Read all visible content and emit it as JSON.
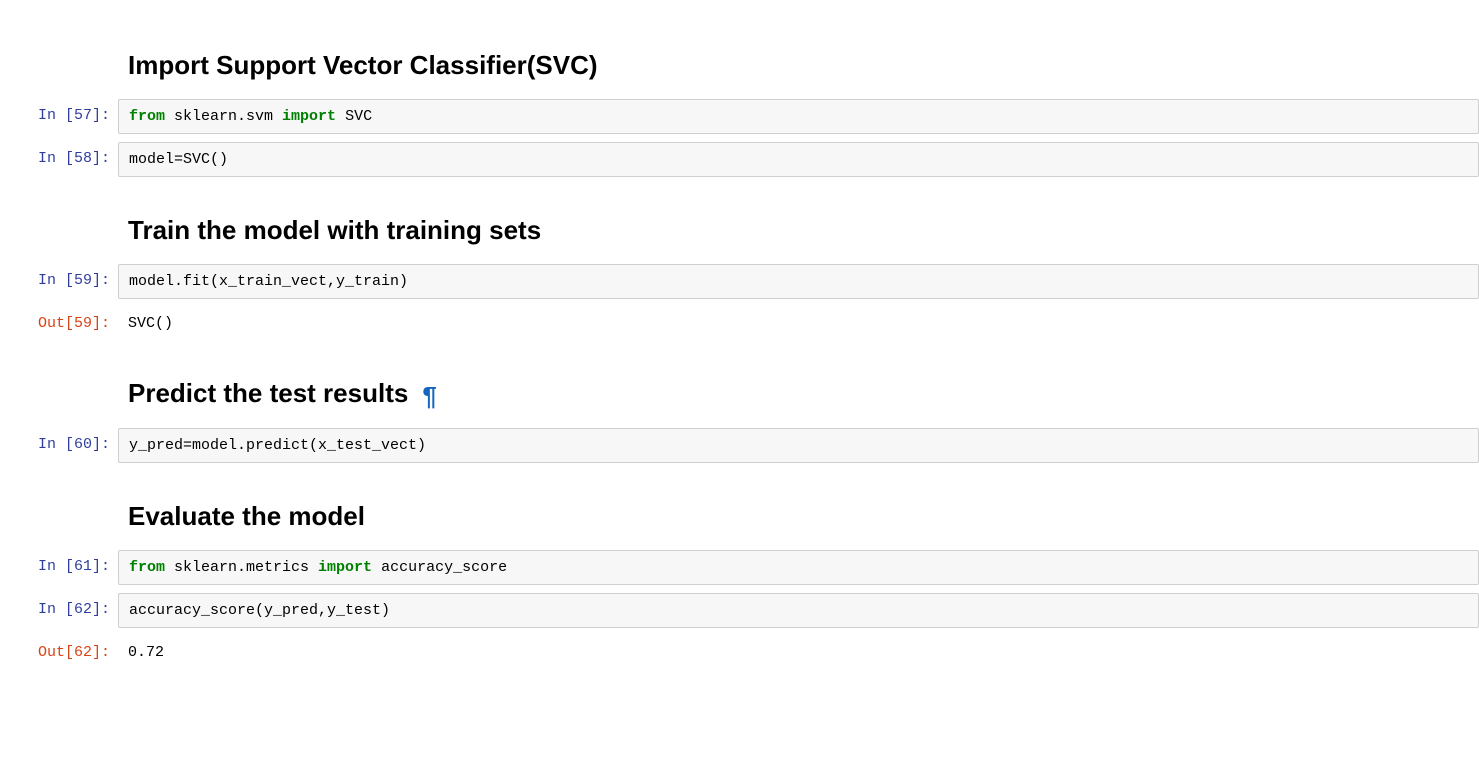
{
  "cells": [
    {
      "type": "markdown",
      "heading": "Import Support Vector Classifier(SVC)",
      "show_pilcrow": false
    },
    {
      "type": "code",
      "in_label": "In [57]:",
      "code_pre": "",
      "kw1": "from",
      "code_mid1": " sklearn.svm ",
      "kw2": "import",
      "code_mid2": " SVC",
      "code_post": ""
    },
    {
      "type": "code",
      "in_label": "In [58]:",
      "code_plain": "model=SVC()"
    },
    {
      "type": "markdown",
      "heading": "Train the model with training sets",
      "show_pilcrow": false
    },
    {
      "type": "code",
      "in_label": "In [59]:",
      "code_plain": "model.fit(x_train_vect,y_train)",
      "out_label": "Out[59]:",
      "output": "SVC()"
    },
    {
      "type": "markdown",
      "heading": "Predict the test results",
      "show_pilcrow": true
    },
    {
      "type": "code",
      "in_label": "In [60]:",
      "code_plain": "y_pred=model.predict(x_test_vect)"
    },
    {
      "type": "markdown",
      "heading": "Evaluate the model",
      "show_pilcrow": false
    },
    {
      "type": "code",
      "in_label": "In [61]:",
      "code_pre": "",
      "kw1": "from",
      "code_mid1": " sklearn.metrics ",
      "kw2": "import",
      "code_mid2": " accuracy_score",
      "code_post": ""
    },
    {
      "type": "code",
      "in_label": "In [62]:",
      "code_plain": "accuracy_score(y_pred,y_test)",
      "out_label": "Out[62]:",
      "output": "0.72"
    }
  ],
  "pilcrow_glyph": "¶"
}
